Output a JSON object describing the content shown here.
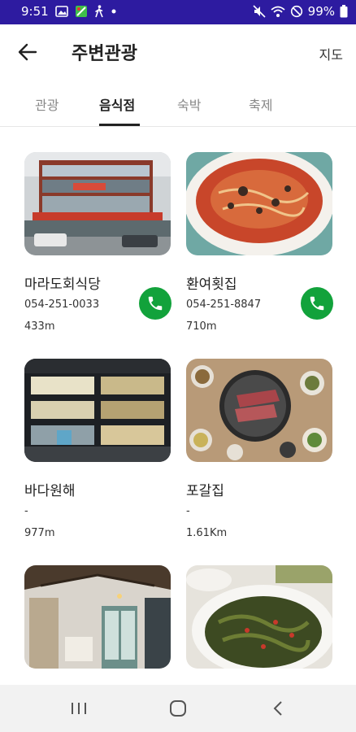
{
  "status_bar": {
    "time": "9:51",
    "battery": "99%",
    "left_icons": [
      "gallery-icon",
      "app-icon",
      "walking-icon",
      "dot-icon"
    ],
    "right_icons": [
      "mute-icon",
      "wifi-icon",
      "do-not-disturb-icon",
      "battery-icon"
    ]
  },
  "header": {
    "title": "주변관광",
    "map_label": "지도",
    "back_icon": "back-arrow-icon"
  },
  "tabs": [
    {
      "label": "관광",
      "active": false
    },
    {
      "label": "음식점",
      "active": true
    },
    {
      "label": "숙박",
      "active": false
    },
    {
      "label": "축제",
      "active": false
    }
  ],
  "places": [
    {
      "name": "마라도회식당",
      "phone": "054-251-0033",
      "distance": "433m",
      "has_call": true,
      "image": "restaurant-building-photo"
    },
    {
      "name": "환여횟집",
      "phone": "054-251-8847",
      "distance": "710m",
      "has_call": true,
      "image": "spicy-noodle-soup-photo"
    },
    {
      "name": "바다원해",
      "phone": "-",
      "distance": "977m",
      "has_call": false,
      "image": "building-at-night-photo"
    },
    {
      "name": "포갈집",
      "phone": "-",
      "distance": "1.61Km",
      "has_call": false,
      "image": "korean-bbq-photo"
    },
    {
      "name": "",
      "phone": "",
      "distance": "",
      "has_call": false,
      "image": "cafe-interior-photo"
    },
    {
      "name": "",
      "phone": "",
      "distance": "",
      "has_call": false,
      "image": "seaweed-dish-photo"
    }
  ],
  "nav_bar": {
    "icons": [
      "recent-apps-icon",
      "home-icon",
      "back-icon"
    ]
  },
  "colors": {
    "status_bar": "#2d1ba0",
    "call_button": "#12a23b",
    "active_tab": "#222222",
    "inactive_tab": "#888888"
  }
}
